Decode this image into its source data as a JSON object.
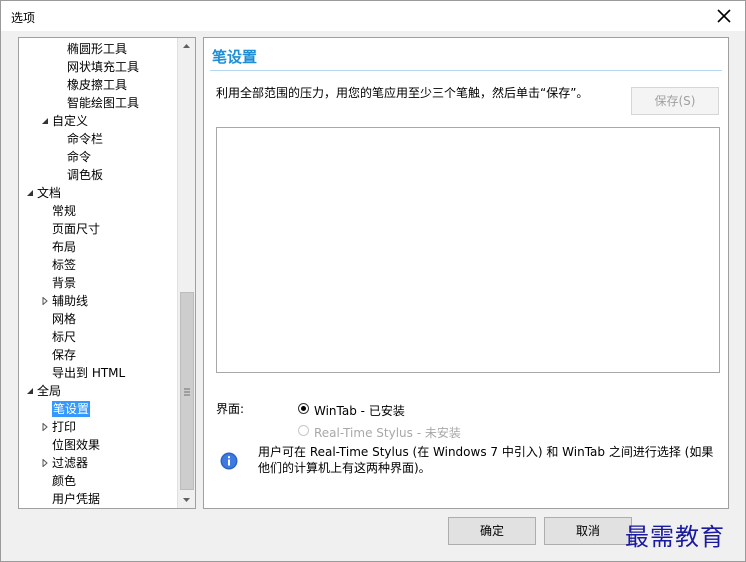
{
  "window": {
    "title": "选项"
  },
  "tree": {
    "items": [
      {
        "label": "椭圆形工具",
        "level": 2
      },
      {
        "label": "网状填充工具",
        "level": 2
      },
      {
        "label": "橡皮擦工具",
        "level": 2
      },
      {
        "label": "智能绘图工具",
        "level": 2
      },
      {
        "label": "自定义",
        "level": 1,
        "expanded": true
      },
      {
        "label": "命令栏",
        "level": 2
      },
      {
        "label": "命令",
        "level": 2
      },
      {
        "label": "调色板",
        "level": 2
      },
      {
        "label": "文档",
        "level": 0,
        "expanded": true
      },
      {
        "label": "常规",
        "level": 1
      },
      {
        "label": "页面尺寸",
        "level": 1
      },
      {
        "label": "布局",
        "level": 1
      },
      {
        "label": "标签",
        "level": 1
      },
      {
        "label": "背景",
        "level": 1
      },
      {
        "label": "辅助线",
        "level": 1,
        "expanded": false
      },
      {
        "label": "网格",
        "level": 1
      },
      {
        "label": "标尺",
        "level": 1
      },
      {
        "label": "保存",
        "level": 1
      },
      {
        "label": "导出到 HTML",
        "level": 1
      },
      {
        "label": "全局",
        "level": 0,
        "expanded": true
      },
      {
        "label": "笔设置",
        "level": 1,
        "selected": true
      },
      {
        "label": "打印",
        "level": 1,
        "expanded": false
      },
      {
        "label": "位图效果",
        "level": 1
      },
      {
        "label": "过滤器",
        "level": 1,
        "expanded": false
      },
      {
        "label": "颜色",
        "level": 1
      },
      {
        "label": "用户凭据",
        "level": 1
      }
    ]
  },
  "panel": {
    "title": "笔设置",
    "instruction": "利用全部范围的压力，用您的笔应用至少三个笔触，然后单击“保存”。",
    "save_label": "保存(S)",
    "interface_label": "界面:",
    "options": [
      {
        "label": "WinTab - 已安装",
        "selected": true,
        "enabled": true
      },
      {
        "label": "Real-Time Stylus - 未安装",
        "selected": false,
        "enabled": false
      }
    ],
    "info_text": "用户可在 Real-Time Stylus (在 Windows 7 中引入) 和 WinTab 之间进行选择 (如果他们的计算机上有这两种界面)。"
  },
  "footer": {
    "ok_label": "确定",
    "cancel_label": "取消",
    "watermark": "最需教育"
  },
  "colors": {
    "accent": "#1e8fd6",
    "selection": "#3399ff"
  }
}
